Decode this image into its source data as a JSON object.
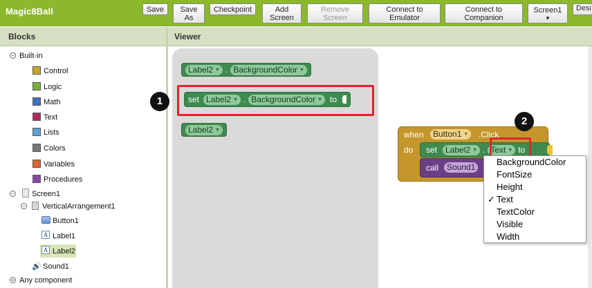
{
  "app": {
    "title": "Magic8Ball"
  },
  "toolbar": {
    "save": "Save",
    "save_as": [
      "Save",
      "As"
    ],
    "checkpoint": "Checkpoint",
    "add_screen": [
      "Add",
      "Screen"
    ],
    "remove_screen": [
      "Remove",
      "Screen"
    ],
    "connect_emulator": [
      "Connect to",
      "Emulator"
    ],
    "connect_companion": [
      "Connect to",
      "Companion"
    ],
    "screen_select": "Screen1",
    "designer_cut": "Desi"
  },
  "panels": {
    "blocks_header": "Blocks",
    "viewer_header": "Viewer"
  },
  "tree": {
    "builtin": "Built-in",
    "builtin_items": [
      {
        "label": "Control",
        "color": "#c9a227"
      },
      {
        "label": "Logic",
        "color": "#78b339"
      },
      {
        "label": "Math",
        "color": "#3d6fc4"
      },
      {
        "label": "Text",
        "color": "#b4265d"
      },
      {
        "label": "Lists",
        "color": "#5aa2d9"
      },
      {
        "label": "Colors",
        "color": "#7a7a7a"
      },
      {
        "label": "Variables",
        "color": "#e0652b"
      },
      {
        "label": "Procedures",
        "color": "#8b4aa6"
      }
    ],
    "screen": "Screen1",
    "vertical_arrangement": "VerticalArrangement1",
    "button1": "Button1",
    "label1": "Label1",
    "label2": "Label2",
    "sound1": "Sound1",
    "any_component": "Any component"
  },
  "flyout": {
    "getter": {
      "component": "Label2",
      "dot": ".",
      "property": "BackgroundColor"
    },
    "setter": {
      "set": "set",
      "component": "Label2",
      "dot": ".",
      "property": "BackgroundColor",
      "to": "to"
    },
    "component_block": {
      "component": "Label2"
    }
  },
  "workspace": {
    "event": {
      "when": "when",
      "component": "Button1",
      "event_name": ".Click",
      "do": "do"
    },
    "set_block": {
      "set": "set",
      "component": "Label2",
      "dot": ".",
      "property": "Text",
      "to": "to"
    },
    "call_block": {
      "call": "call",
      "component": "Sound1"
    }
  },
  "callouts": {
    "one": "1",
    "two": "2",
    "highlight_color": "#e0242e"
  },
  "property_menu": {
    "items": [
      "BackgroundColor",
      "FontSize",
      "Height",
      "Text",
      "TextColor",
      "Visible",
      "Width"
    ],
    "checked": "✓"
  }
}
